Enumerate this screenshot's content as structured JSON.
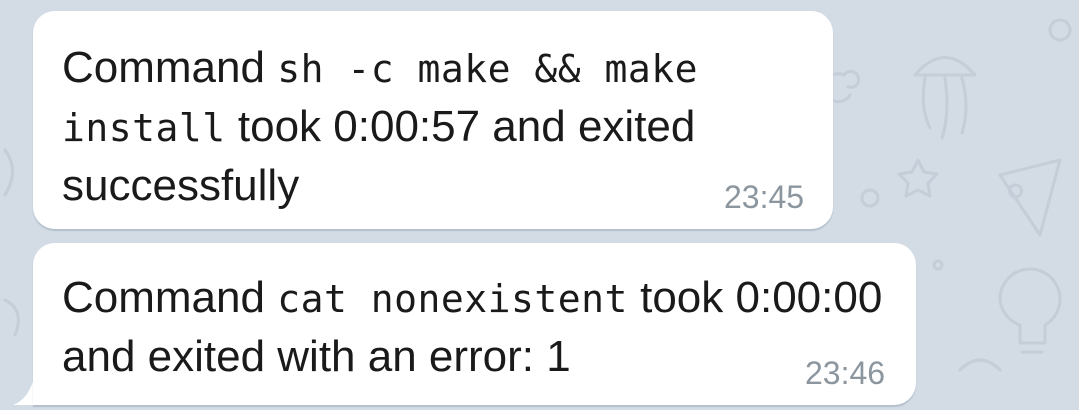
{
  "messages": [
    {
      "prefix": "Command",
      "command_line1": "sh -c make && make",
      "command_line2": "install",
      "suffix": "took 0:00:57 and exited successfully",
      "time": "23:45"
    },
    {
      "prefix": "Command",
      "command": "cat nonexistent",
      "suffix": "took 0:00:00 and exited with an error: 1",
      "time": "23:46"
    }
  ],
  "colors": {
    "background": "#d3dbe4",
    "bubble": "#ffffff",
    "timestamp": "#8c969f",
    "text": "#1a1a1a"
  }
}
